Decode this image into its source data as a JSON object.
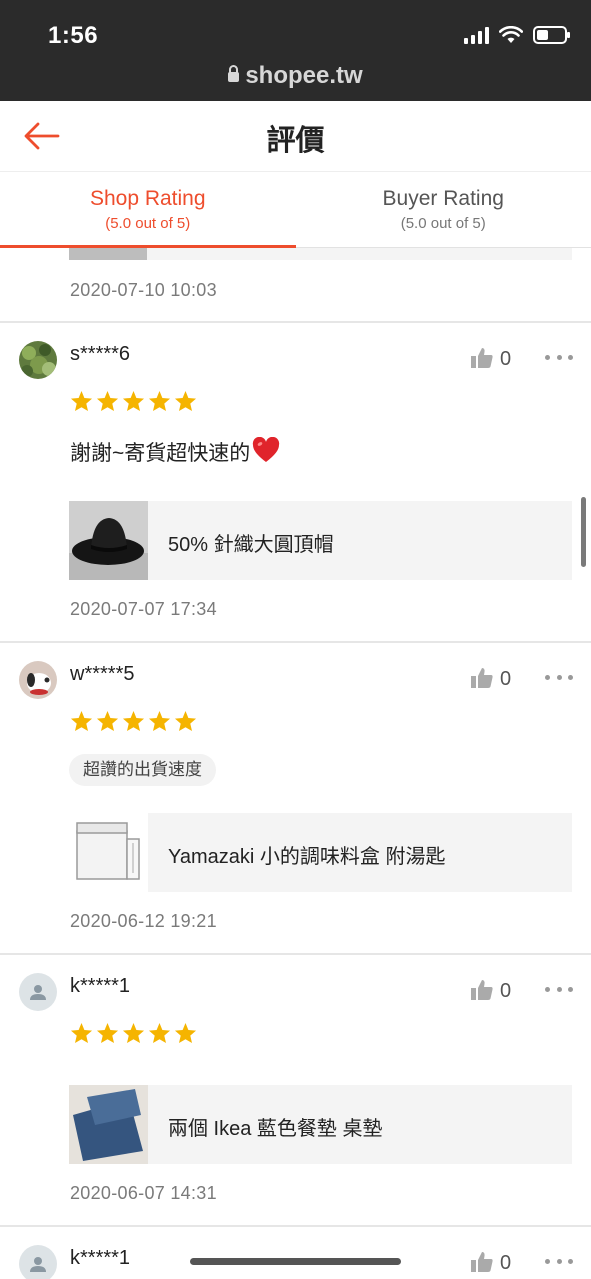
{
  "status_bar": {
    "time": "1:56",
    "url": "shopee.tw"
  },
  "header": {
    "title": "評價"
  },
  "tabs": [
    {
      "label": "Shop Rating",
      "sub": "(5.0 out of 5)",
      "active": true
    },
    {
      "label": "Buyer Rating",
      "sub": "(5.0 out of 5)",
      "active": false
    }
  ],
  "colors": {
    "accent": "#ee4d2d",
    "star": "#f5b400"
  },
  "top_partial": {
    "date": "2020-07-10 10:03"
  },
  "reviews": [
    {
      "username": "s*****6",
      "likes": "0",
      "stars": 5,
      "comment": "謝謝~寄貨超快速的",
      "product": "50% 針織大圓頂帽",
      "date": "2020-07-07 17:34"
    },
    {
      "username": "w*****5",
      "likes": "0",
      "stars": 5,
      "tag": "超讚的出貨速度",
      "product": "Yamazaki 小的調味料盒 附湯匙",
      "date": "2020-06-12 19:21"
    },
    {
      "username": "k*****1",
      "likes": "0",
      "stars": 5,
      "product": "兩個 Ikea 藍色餐墊 桌墊",
      "date": "2020-06-07 14:31"
    },
    {
      "username": "k*****1",
      "likes": "0"
    }
  ]
}
